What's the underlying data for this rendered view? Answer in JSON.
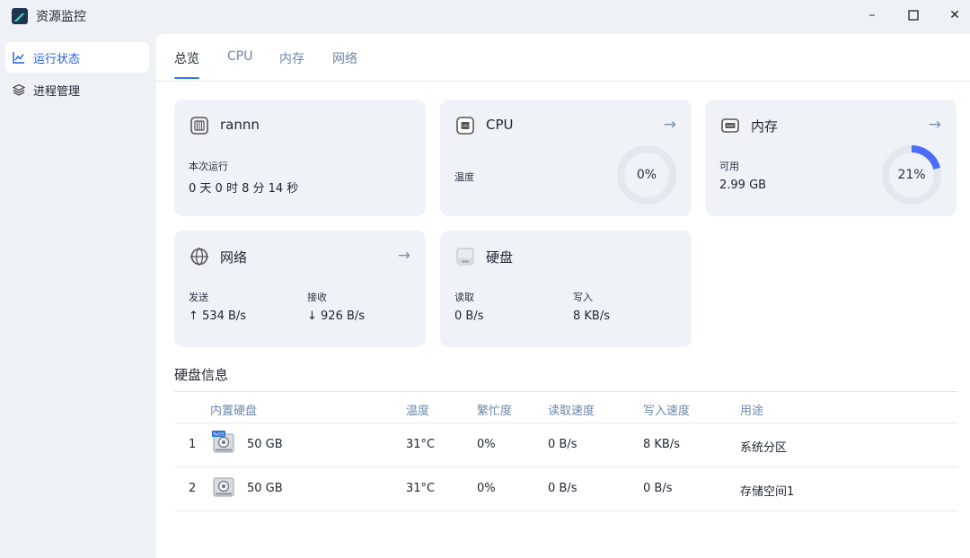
{
  "window": {
    "title": "资源监控",
    "controls": {
      "minimize": "–",
      "maximize": "☐",
      "close": "✕"
    }
  },
  "sidebar": {
    "items": [
      {
        "label": "运行状态",
        "icon": "chart-line-icon",
        "active": true
      },
      {
        "label": "进程管理",
        "icon": "layers-icon",
        "active": false
      }
    ]
  },
  "tabs": [
    {
      "label": "总览",
      "active": true
    },
    {
      "label": "CPU",
      "active": false
    },
    {
      "label": "内存",
      "active": false
    },
    {
      "label": "网络",
      "active": false
    }
  ],
  "cards": {
    "system": {
      "title": "rannn",
      "uptime_label": "本次运行",
      "uptime_value": "0 天 0 时 8 分 14 秒"
    },
    "cpu": {
      "title": "CPU",
      "temp_label": "温度",
      "usage_text": "0%",
      "usage_fraction": 0.0
    },
    "memory": {
      "title": "内存",
      "available_label": "可用",
      "available_value": "2.99 GB",
      "usage_text": "21%",
      "usage_fraction": 0.21
    },
    "network": {
      "title": "网络",
      "send_label": "发送",
      "send_value": "↑ 534 B/s",
      "recv_label": "接收",
      "recv_value": "↓ 926 B/s"
    },
    "disk": {
      "title": "硬盘",
      "read_label": "读取",
      "read_value": "0 B/s",
      "write_label": "写入",
      "write_value": "8 KB/s"
    }
  },
  "disk_info": {
    "title": "硬盘信息",
    "headers": [
      "内置硬盘",
      "温度",
      "繁忙度",
      "读取速度",
      "写入速度",
      "用途"
    ],
    "rows": [
      {
        "index": "1",
        "badge": "ReOS",
        "size": "50 GB",
        "temp": "31°C",
        "busy": "0%",
        "read": "0 B/s",
        "write": "8 KB/s",
        "usage": "系统分区"
      },
      {
        "index": "2",
        "badge": "",
        "size": "50 GB",
        "temp": "31°C",
        "busy": "0%",
        "read": "0 B/s",
        "write": "0 B/s",
        "usage": "存储空间1"
      }
    ]
  },
  "colors": {
    "accent": "#3278e6",
    "gauge_arc": "#4a6cf7",
    "gauge_track": "#e3e7ee",
    "card_bg": "#eff2f7"
  }
}
